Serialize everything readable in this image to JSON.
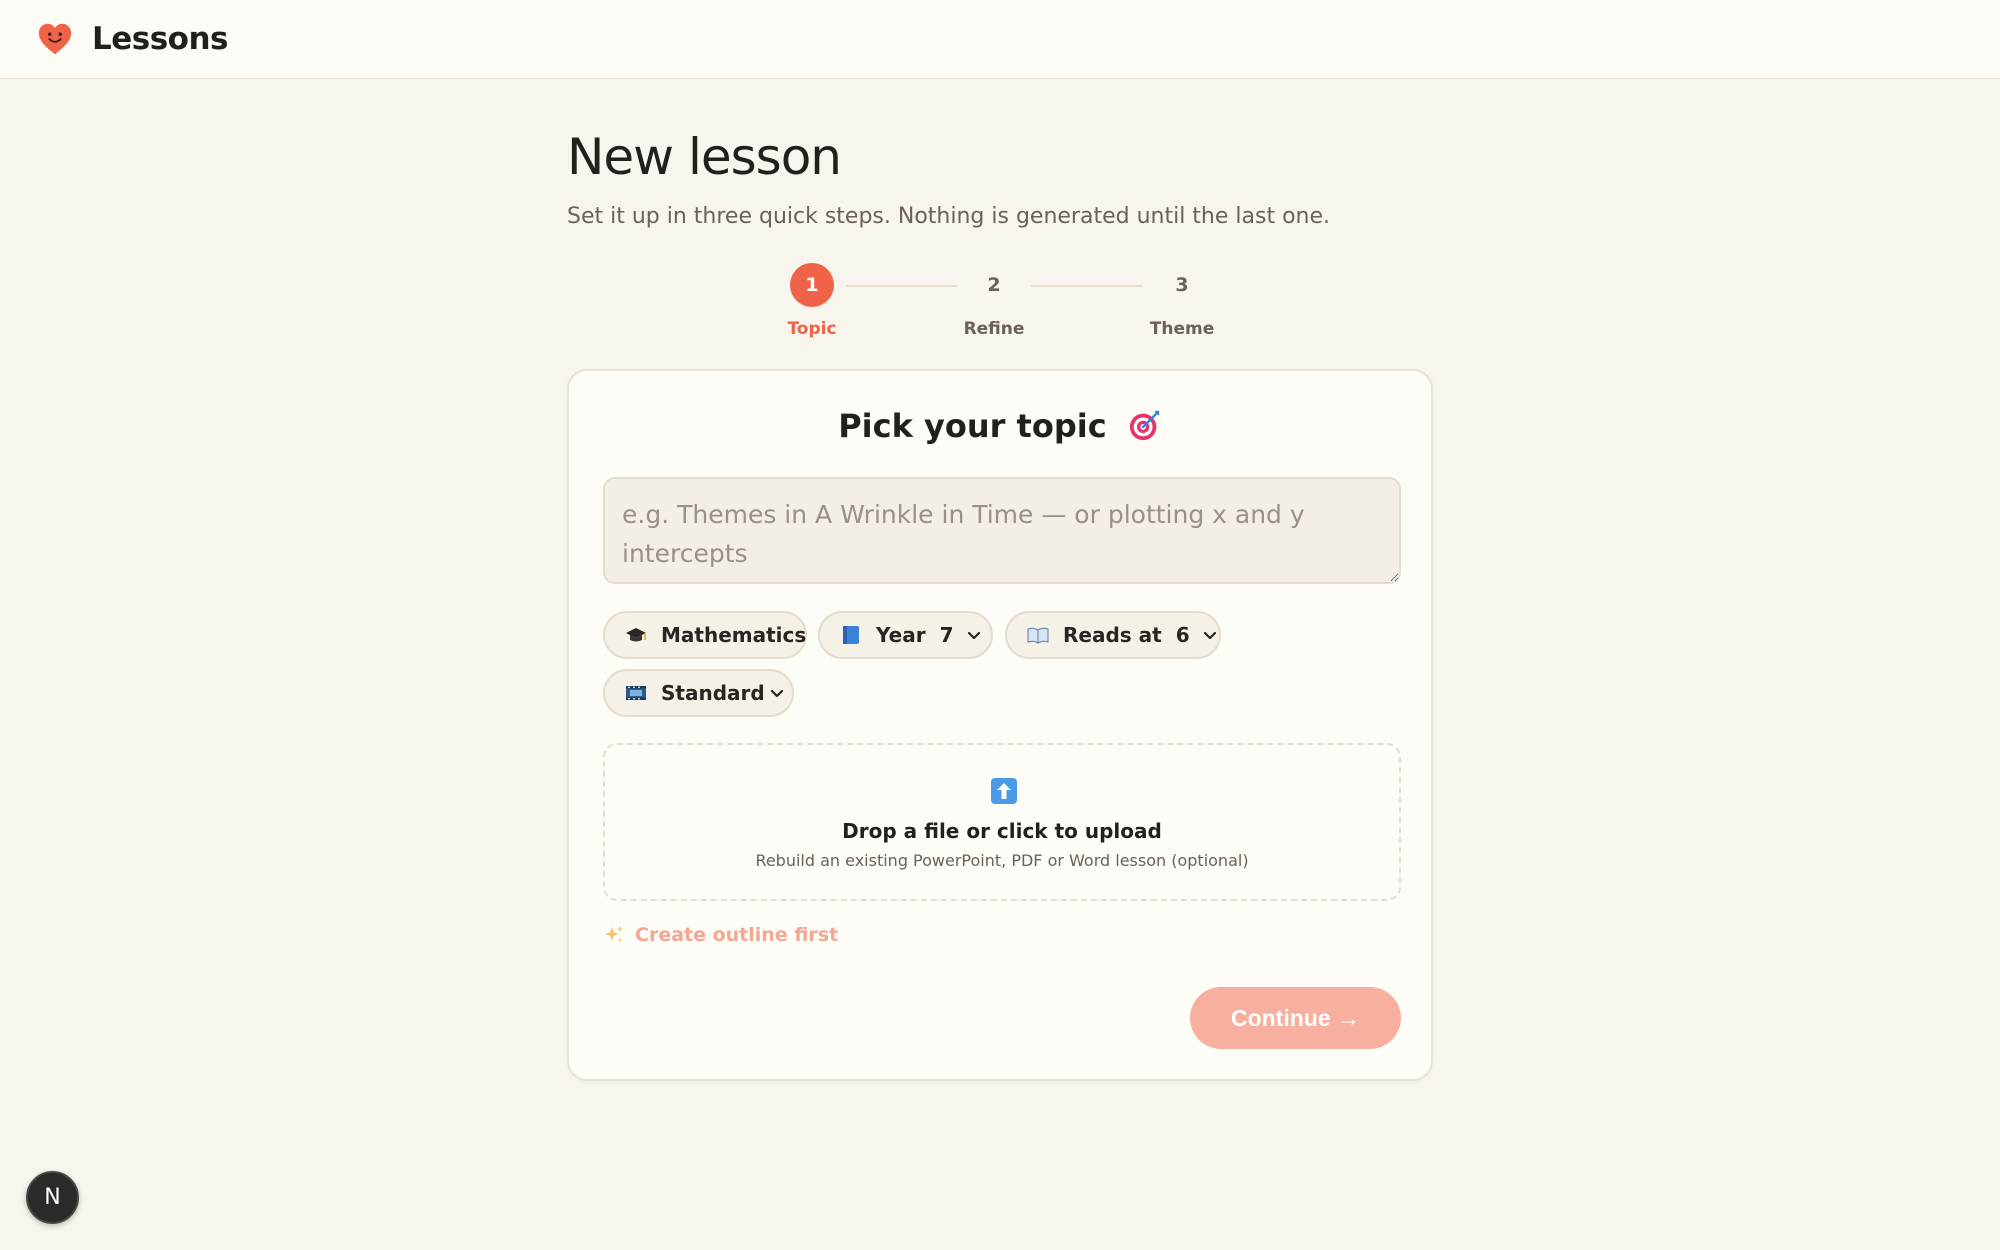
{
  "header": {
    "app_title": "Lessons",
    "logo_icon": "heart-face-icon"
  },
  "page": {
    "title": "New lesson",
    "subtitle": "Set it up in three quick steps. Nothing is generated until the last one."
  },
  "stepper": {
    "steps": [
      {
        "number": "1",
        "label": "Topic",
        "active": true
      },
      {
        "number": "2",
        "label": "Refine",
        "active": false
      },
      {
        "number": "3",
        "label": "Theme",
        "active": false
      }
    ]
  },
  "card": {
    "title": "Pick your topic",
    "title_icon": "target-icon",
    "topic_input": {
      "value": "",
      "placeholder": "e.g. Themes in A Wrinkle in Time — or plotting x and y intercepts"
    },
    "pills": {
      "subject": {
        "icon": "graduation-cap-icon",
        "label": "Mathematics"
      },
      "year": {
        "icon": "blue-book-icon",
        "label": "Year",
        "value": "7"
      },
      "reads_at": {
        "icon": "open-book-icon",
        "label": "Reads at",
        "value": "6"
      },
      "format": {
        "icon": "film-icon",
        "label": "Standard"
      }
    },
    "upload": {
      "icon": "upload-arrow-icon",
      "title": "Drop a file or click to upload",
      "subtitle": "Rebuild an existing PowerPoint, PDF or Word lesson (optional)"
    },
    "outline_link": "Create outline first",
    "continue_button": "Continue →"
  },
  "badge": {
    "letter": "N"
  },
  "colors": {
    "accent": "#ef6448",
    "accent_disabled": "#f7b0a0",
    "background": "#f8f5ee",
    "card": "#fefcf7"
  }
}
